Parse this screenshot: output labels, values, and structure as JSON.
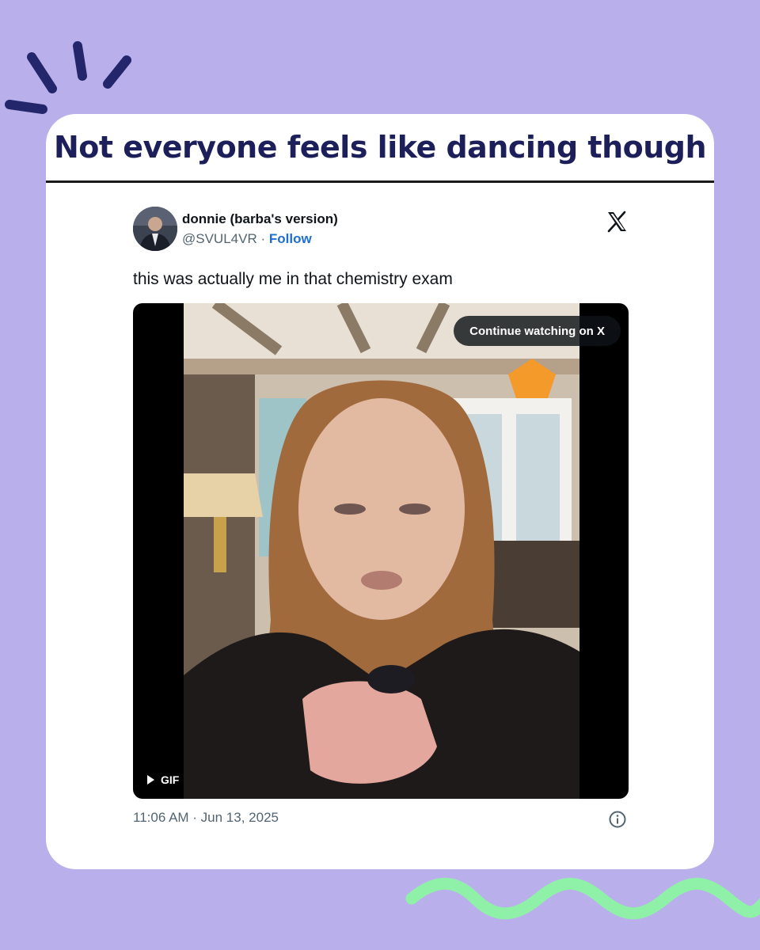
{
  "post": {
    "headline": "Not everyone feels like dancing though"
  },
  "tweet": {
    "display_name": "donnie (barba's version)",
    "handle": "@SVUL4VR",
    "separator": " · ",
    "follow_label": "Follow",
    "text": "this was actually me in that chemistry exam",
    "media": {
      "continue_label": "Continue watching on X",
      "badge_label": "GIF"
    },
    "timestamp": "11:06 AM · Jun 13, 2025"
  },
  "colors": {
    "background": "#b9b0eb",
    "headline": "#1d1f5a",
    "link": "#1d6fd6",
    "wave": "#8ff0a8",
    "burst": "#23266b"
  },
  "icons": [
    "x-logo-icon",
    "play-icon",
    "info-icon",
    "burst-decoration",
    "wave-decoration"
  ]
}
